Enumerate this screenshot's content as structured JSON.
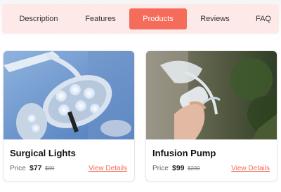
{
  "tabs": [
    {
      "label": "Description",
      "active": false
    },
    {
      "label": "Features",
      "active": false
    },
    {
      "label": "Products",
      "active": true
    },
    {
      "label": "Reviews",
      "active": false
    },
    {
      "label": "FAQ",
      "active": false
    }
  ],
  "products": [
    {
      "title": "Surgical Lights",
      "price_label": "Price",
      "price": "$77",
      "old_price": "$89",
      "link": "View Details"
    },
    {
      "title": "Infusion Pump",
      "price_label": "Price",
      "price": "$99",
      "old_price": "$230",
      "link": "View Details"
    }
  ],
  "colors": {
    "accent": "#f56c5b",
    "tab_bar": "#fde9e7"
  }
}
